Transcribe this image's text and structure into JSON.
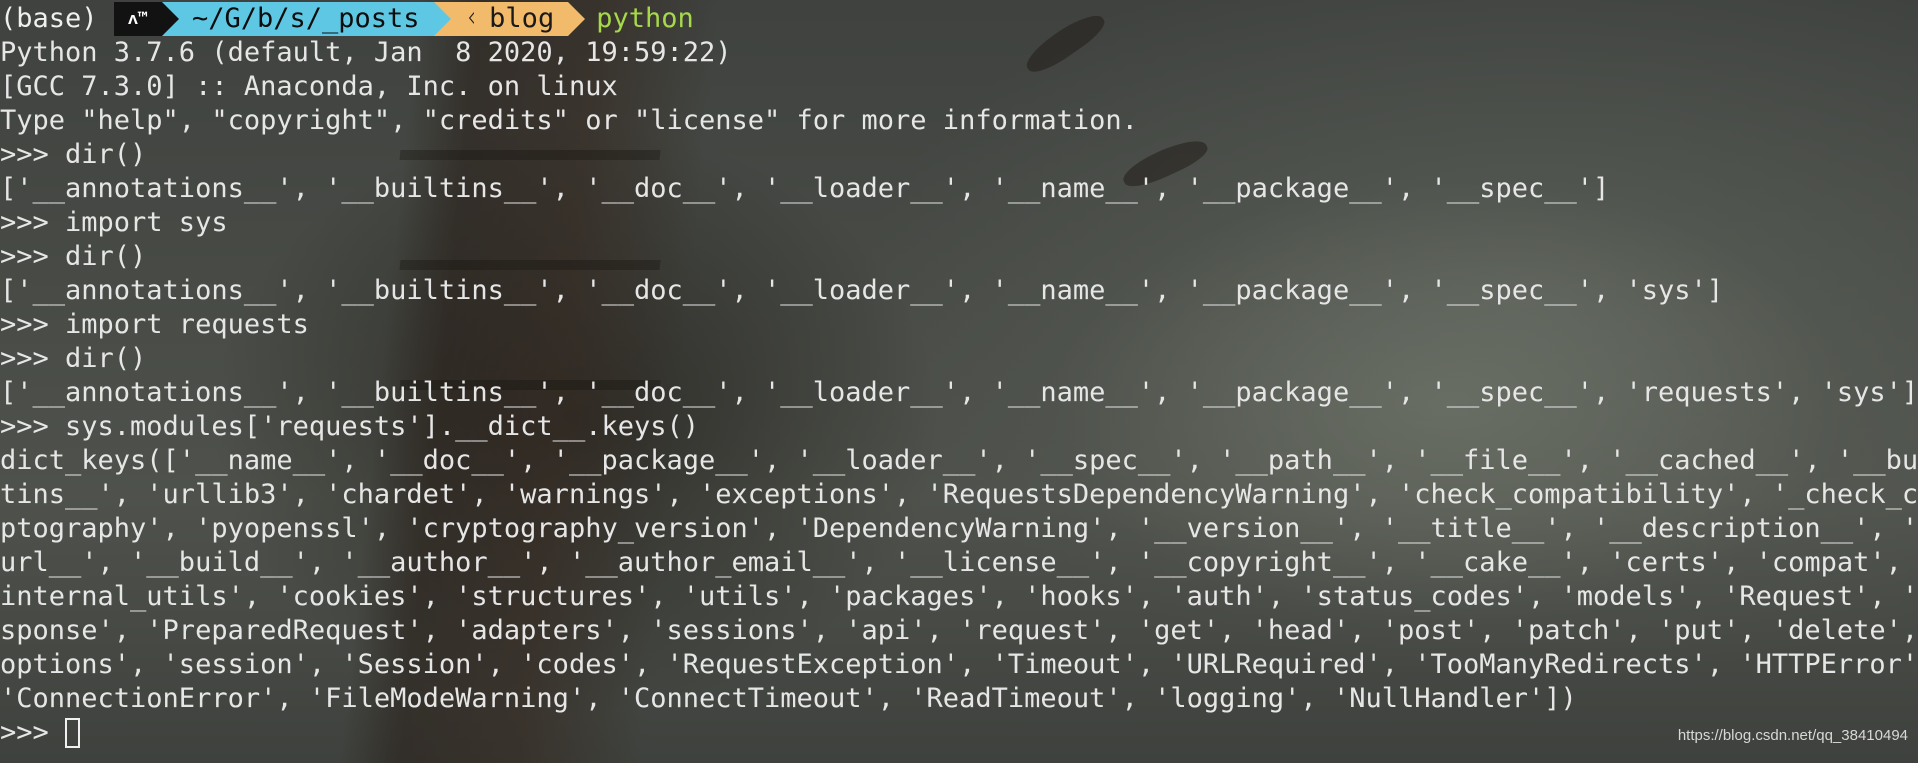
{
  "prompt": {
    "env": "(base)",
    "user_segment": "ᴧ™",
    "dir_segment": "~/G/b/s/_posts",
    "branch_icon": "git-branch-icon",
    "branch_glyph": "ᚲ",
    "branch": "blog",
    "command": "python"
  },
  "output_lines": [
    "Python 3.7.6 (default, Jan  8 2020, 19:59:22)",
    "[GCC 7.3.0] :: Anaconda, Inc. on linux",
    "Type \"help\", \"copyright\", \"credits\" or \"license\" for more information.",
    ">>> dir()",
    "['__annotations__', '__builtins__', '__doc__', '__loader__', '__name__', '__package__', '__spec__']",
    ">>> import sys",
    ">>> dir()",
    "['__annotations__', '__builtins__', '__doc__', '__loader__', '__name__', '__package__', '__spec__', 'sys']",
    ">>> import requests",
    ">>> dir()",
    "['__annotations__', '__builtins__', '__doc__', '__loader__', '__name__', '__package__', '__spec__', 'requests', 'sys']",
    ">>> sys.modules['requests'].__dict__.keys()",
    "dict_keys(['__name__', '__doc__', '__package__', '__loader__', '__spec__', '__path__', '__file__', '__cached__', '__buil",
    "tins__', 'urllib3', 'chardet', 'warnings', 'exceptions', 'RequestsDependencyWarning', 'check_compatibility', '_check_cry",
    "ptography', 'pyopenssl', 'cryptography_version', 'DependencyWarning', '__version__', '__title__', '__description__', '__",
    "url__', '__build__', '__author__', '__author_email__', '__license__', '__copyright__', '__cake__', 'certs', 'compat', '_",
    "internal_utils', 'cookies', 'structures', 'utils', 'packages', 'hooks', 'auth', 'status_codes', 'models', 'Request', 'Re",
    "sponse', 'PreparedRequest', 'adapters', 'sessions', 'api', 'request', 'get', 'head', 'post', 'patch', 'put', 'delete', '",
    "options', 'session', 'Session', 'codes', 'RequestException', 'Timeout', 'URLRequired', 'TooManyRedirects', 'HTTPError',",
    "'ConnectionError', 'FileModeWarning', 'ConnectTimeout', 'ReadTimeout', 'logging', 'NullHandler'])"
  ],
  "current_prompt": ">>> ",
  "watermark": "https://blog.csdn.net/qq_38410494",
  "colors": {
    "dir_segment_bg": "#5ec8e4",
    "git_segment_bg": "#f2bb6b",
    "user_segment_bg": "#121212",
    "command_fg": "#a6d84a",
    "text_fg": "#e6e6e6"
  }
}
